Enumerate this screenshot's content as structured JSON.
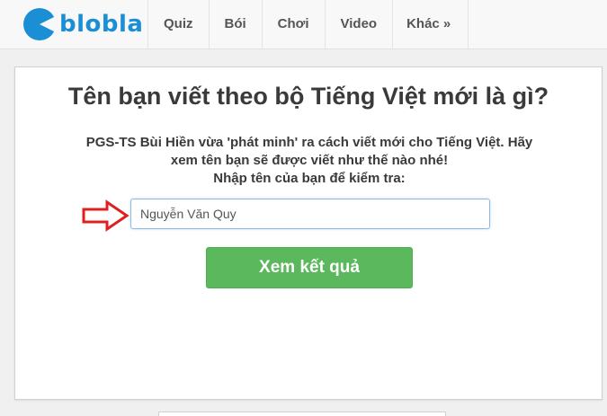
{
  "brand": {
    "name": "blobla",
    "color": "#1a8fd6"
  },
  "nav": {
    "items": [
      {
        "label": "Quiz"
      },
      {
        "label": "Bói"
      },
      {
        "label": "Chơi"
      },
      {
        "label": "Video"
      },
      {
        "label": "Khác »"
      }
    ]
  },
  "main": {
    "title": "Tên bạn viết theo bộ Tiếng Việt mới là gì?",
    "desc_line1": "PGS-TS Bùi Hiền vừa 'phát minh' ra cách viết mới cho Tiếng Việt. Hãy",
    "desc_line2": "xem tên bạn sẽ được viết như thế nào nhé!",
    "prompt": "Nhập tên của bạn để kiểm tra:",
    "name_value": "Nguyễn Văn Quy",
    "submit_label": "Xem kết quả",
    "arrow_icon": "right-arrow-icon",
    "arrow_color": "#e02020",
    "button_color": "#5cb85c"
  }
}
